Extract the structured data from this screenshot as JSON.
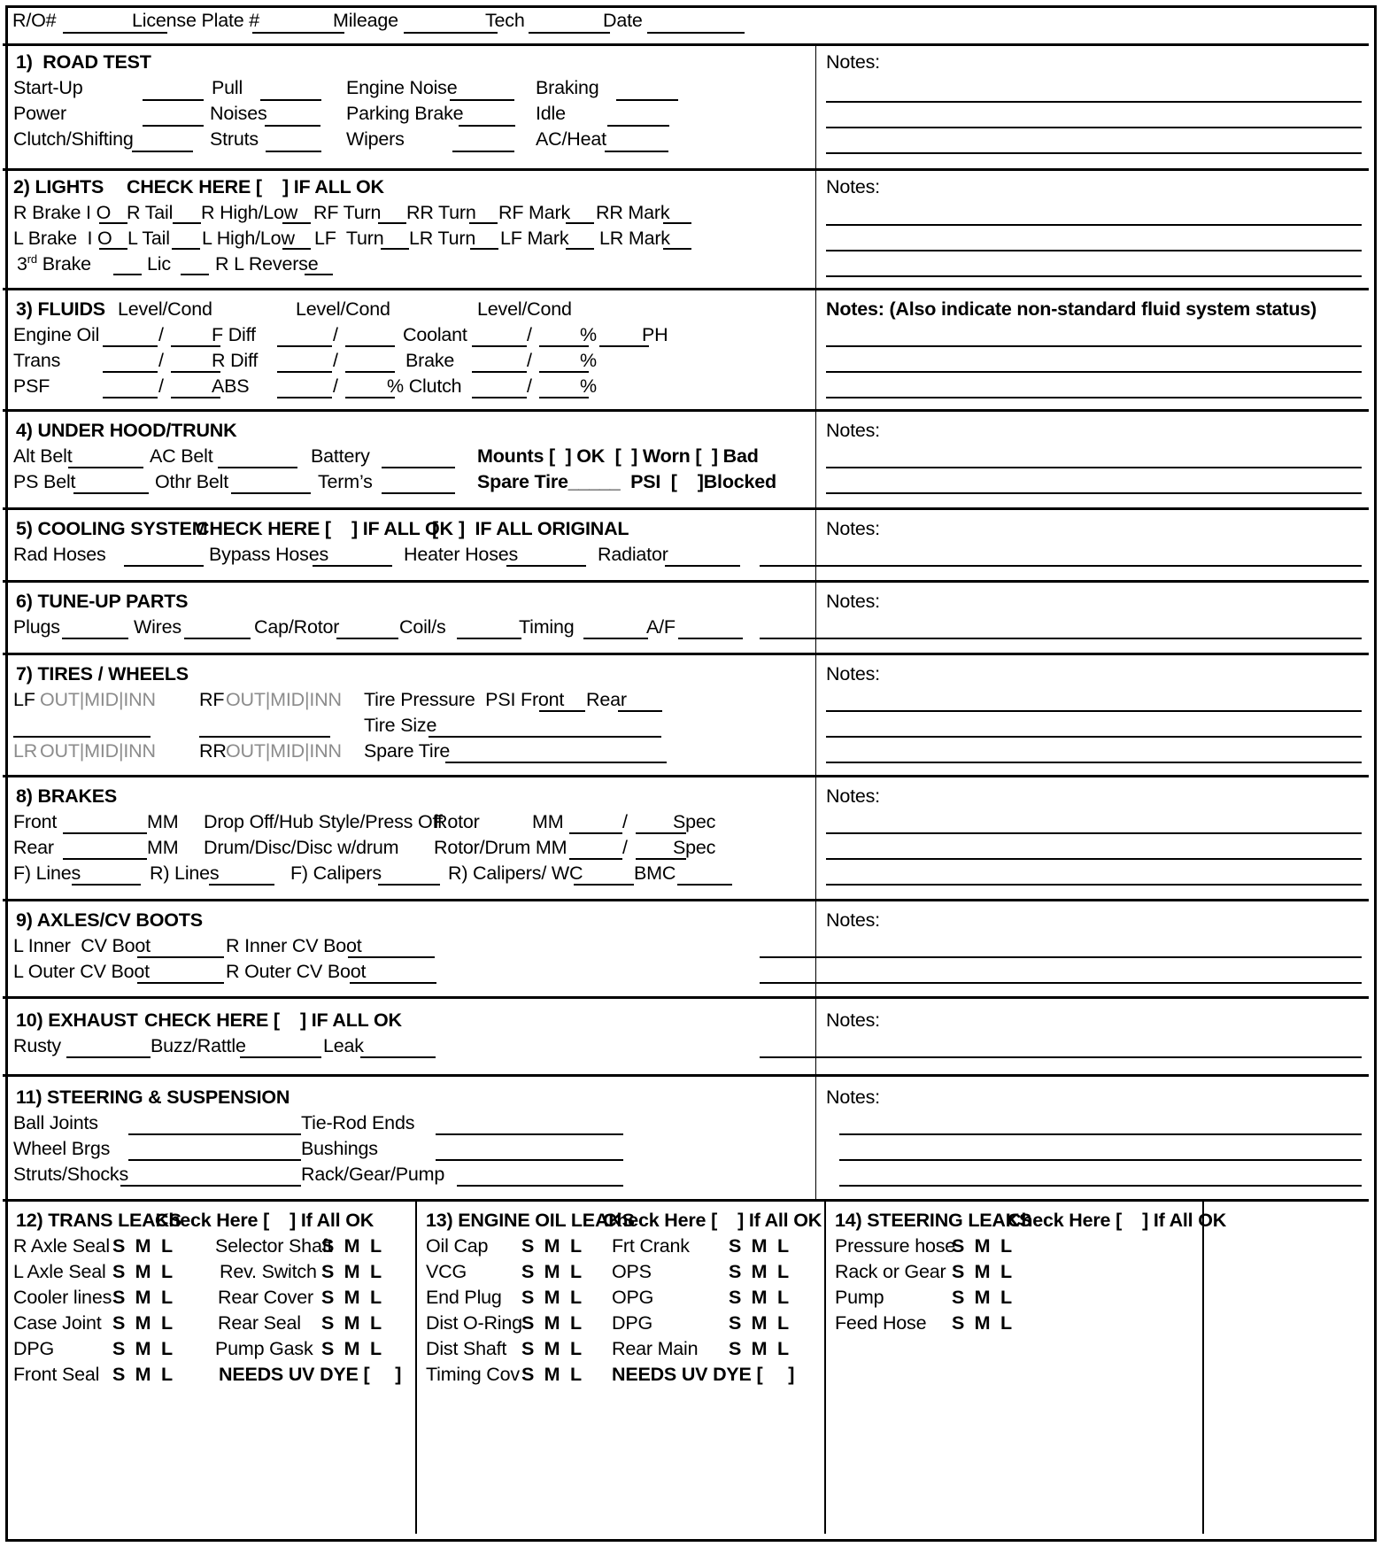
{
  "header": {
    "fields": [
      {
        "label": "R/O#",
        "line_w": 118
      },
      {
        "label": "License Plate #",
        "line_w": 104
      },
      {
        "label": "Mileage",
        "line_w": 106
      },
      {
        "label": "Tech",
        "line_w": 92
      },
      {
        "label": "Date",
        "line_w": 110
      }
    ]
  },
  "notes_label": "Notes:",
  "notes_label_fluids": "Notes: (Also indicate non-standard fluid system status)",
  "sections": {
    "road_test": {
      "title": "1)  ROAD TEST",
      "rows": [
        [
          "Start-Up",
          "Pull",
          "Engine Noise",
          "Braking"
        ],
        [
          "Power",
          "Noises",
          "Parking Brake",
          "Idle"
        ],
        [
          "Clutch/Shifting",
          "Struts",
          "Wipers",
          "AC/Heat"
        ]
      ]
    },
    "lights": {
      "title": "2) LIGHTS",
      "check_text": "CHECK HERE [    ] IF ALL OK",
      "row1": [
        "R Brake I O",
        "R Tail",
        "R High/Low",
        "RF Turn",
        "RR Turn",
        "RF Mark",
        "RR Mark"
      ],
      "row2": [
        "L Brake  I O",
        "L Tail",
        "L High/Low",
        "LF  Turn",
        "LR Turn",
        "LF Mark",
        "LR Mark"
      ],
      "row3_prefix": "3",
      "row3_sup": "rd",
      "row3": [
        "Brake",
        "Lic",
        "R L Reverse"
      ]
    },
    "fluids": {
      "title": "3) FLUIDS",
      "col_headers": [
        "Level/Cond",
        "Level/Cond",
        "Level/Cond"
      ],
      "rows": [
        [
          "Engine Oil",
          "F Diff",
          "Coolant",
          "%",
          "PH"
        ],
        [
          "Trans",
          "R Diff",
          "Brake",
          "%"
        ],
        [
          "PSF",
          "ABS",
          "% Clutch",
          "%"
        ]
      ]
    },
    "under_hood": {
      "title": "4) UNDER HOOD/TRUNK",
      "row1": [
        "Alt Belt",
        "AC Belt",
        "Battery"
      ],
      "row1_bold": "Mounts [  ] OK  [  ] Worn [  ] Bad",
      "row2": [
        "PS Belt",
        "Othr Belt",
        "Term’s"
      ],
      "row2_bold": "Spare Tire_____  PSI  [    ]Blocked"
    },
    "cooling": {
      "title": "5) COOLING SYSTEM",
      "check1": "CHECK HERE [    ] IF ALL OK",
      "check2": "[    ]  IF ALL ORIGINAL",
      "row": [
        "Rad Hoses",
        "Bypass Hoses",
        "Heater Hoses",
        "Radiator"
      ]
    },
    "tuneup": {
      "title": "6) TUNE-UP PARTS",
      "row": [
        "Plugs",
        "Wires",
        "Cap/Rotor",
        "Coil/s",
        "Timing",
        "A/F"
      ]
    },
    "tires": {
      "title": "7) TIRES / WHEELS",
      "pos_lf": "LF",
      "pos_rf": "RF",
      "pos_lr": "LR",
      "pos_rr": "RR",
      "tread": "OUT|MID|INN",
      "pressure_label": "Tire Pressure  PSI Front",
      "rear_label": "Rear",
      "tire_size": "Tire Size",
      "spare_tire": "Spare Tire"
    },
    "brakes": {
      "title": "8) BRAKES",
      "row1": [
        "Front",
        "MM",
        "Drop Off/Hub Style/Press Off",
        "Rotor",
        "MM",
        "Spec"
      ],
      "row2": [
        "Rear",
        "MM",
        "Drum/Disc/Disc w/drum",
        "Rotor/Drum MM",
        "Spec"
      ],
      "row3": [
        "F) Lines",
        "R) Lines",
        "F) Calipers",
        "R) Calipers/ WC",
        "BMC"
      ]
    },
    "axles": {
      "title": "9) AXLES/CV BOOTS",
      "row1": [
        "L Inner  CV Boot",
        "R Inner CV Boot"
      ],
      "row2": [
        "L Outer CV Boot",
        "R Outer CV Boot"
      ]
    },
    "exhaust": {
      "title": "10) EXHAUST",
      "check_text": "CHECK HERE [    ] IF ALL OK",
      "row": [
        "Rusty",
        "Buzz/Rattle",
        "Leak"
      ]
    },
    "steering": {
      "title": "11) STEERING & SUSPENSION",
      "left": [
        "Ball Joints",
        "Wheel Brgs",
        "Struts/Shocks"
      ],
      "right": [
        "Tie-Rod Ends",
        "Bushings",
        "Rack/Gear/Pump"
      ]
    }
  },
  "leaks": {
    "check_suffix": "Check Here [    ] If All OK",
    "sml": "S  M  L",
    "uv_dye": "NEEDS UV DYE [     ]",
    "trans": {
      "title": "12) TRANS LEAKS",
      "left": [
        "R Axle Seal",
        "L Axle Seal",
        "Cooler lines",
        "Case Joint",
        "DPG",
        "Front Seal"
      ],
      "right": [
        "Selector Shaft",
        "Rev. Switch",
        "Rear Cover",
        "Rear Seal",
        "Pump Gask"
      ]
    },
    "engine": {
      "title": "13) ENGINE OIL LEAKS",
      "left": [
        "Oil Cap",
        "VCG",
        "End Plug",
        "Dist O-Ring",
        "Dist Shaft",
        "Timing Cov"
      ],
      "right": [
        "Frt Crank",
        "OPS",
        "OPG",
        "DPG",
        "Rear Main"
      ]
    },
    "steering": {
      "title": "14) STEERING LEAKS",
      "left": [
        "Pressure hose",
        "Rack or Gear",
        "Pump",
        "Feed Hose"
      ]
    }
  }
}
